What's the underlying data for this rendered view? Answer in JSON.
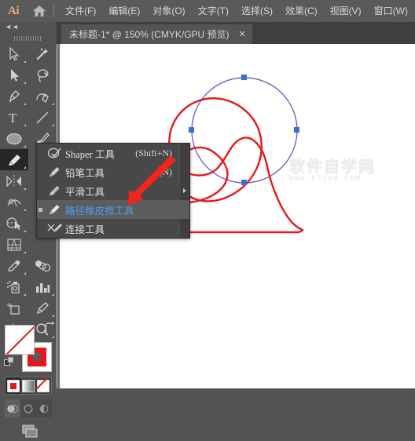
{
  "app": {
    "name": "Ai",
    "logo_icon": "illustrator-logo-icon",
    "home_icon": "home-icon"
  },
  "menubar": {
    "items": [
      {
        "label": "文件(F)",
        "name": "menu-file"
      },
      {
        "label": "编辑(E)",
        "name": "menu-edit"
      },
      {
        "label": "对象(O)",
        "name": "menu-object"
      },
      {
        "label": "文字(T)",
        "name": "menu-type"
      },
      {
        "label": "选择(S)",
        "name": "menu-select"
      },
      {
        "label": "效果(C)",
        "name": "menu-effect"
      },
      {
        "label": "视图(V)",
        "name": "menu-view"
      },
      {
        "label": "窗口(W)",
        "name": "menu-window"
      }
    ]
  },
  "document_tab": {
    "title": "未标题-1* @ 150% (CMYK/GPU 预览)",
    "close_label": "✕"
  },
  "toolbar": {
    "collapse_label": "◄◄",
    "tools": [
      {
        "name": "selection-tool-icon",
        "label": "选择工具"
      },
      {
        "name": "magic-wand-tool-icon",
        "label": "魔棒工具"
      },
      {
        "name": "direct-selection-tool-icon",
        "label": "直接选择工具"
      },
      {
        "name": "lasso-tool-icon",
        "label": "套索工具"
      },
      {
        "name": "pen-tool-icon",
        "label": "钢笔工具"
      },
      {
        "name": "curvature-tool-icon",
        "label": "曲率工具"
      },
      {
        "name": "type-tool-icon",
        "label": "文字工具"
      },
      {
        "name": "line-segment-tool-icon",
        "label": "直线段工具"
      },
      {
        "name": "ellipse-tool-icon",
        "label": "椭圆工具"
      },
      {
        "name": "paintbrush-tool-icon",
        "label": "画笔工具"
      },
      {
        "name": "shaper-tool-icon",
        "label": "Shaper 工具"
      },
      {
        "name": "rotate-tool-icon",
        "label": "旋转工具"
      },
      {
        "name": "reflect-tool-icon",
        "label": "镜像工具"
      },
      {
        "name": "width-tool-icon",
        "label": "宽度工具"
      },
      {
        "name": "free-transform-tool-icon",
        "label": "自由变换工具"
      },
      {
        "name": "shape-builder-tool-icon",
        "label": "形状生成器工具"
      },
      {
        "name": "perspective-grid-tool-icon",
        "label": "透视网格工具"
      },
      {
        "name": "mesh-tool-icon",
        "label": "网格工具"
      },
      {
        "name": "eyedropper-tool-icon",
        "label": "吸管工具"
      },
      {
        "name": "blend-tool-icon",
        "label": "混合工具"
      },
      {
        "name": "symbol-sprayer-tool-icon",
        "label": "符号喷枪工具"
      },
      {
        "name": "column-graph-tool-icon",
        "label": "柱形图工具"
      },
      {
        "name": "artboard-tool-icon",
        "label": "画板工具"
      },
      {
        "name": "slice-tool-icon",
        "label": "切片工具"
      },
      {
        "name": "hand-tool-icon",
        "label": "抓手工具"
      },
      {
        "name": "zoom-tool-icon",
        "label": "缩放工具"
      }
    ],
    "fill_stroke": {
      "fill_name": "fill-swatch",
      "fill_value": "无",
      "stroke_name": "stroke-swatch",
      "stroke_color": "#e8161c",
      "swap_icon": "swap-fill-stroke-icon",
      "default_icon": "default-fill-stroke-icon"
    },
    "paint_modes": [
      {
        "name": "color-swatch-button",
        "label": "颜色"
      },
      {
        "name": "gradient-swatch-button",
        "label": "渐变"
      },
      {
        "name": "none-swatch-button",
        "label": "无"
      }
    ],
    "draw_modes": [
      {
        "name": "draw-normal-button",
        "label": "正常绘图"
      },
      {
        "name": "draw-behind-button",
        "label": "背面绘图"
      },
      {
        "name": "draw-inside-button",
        "label": "内部绘图"
      }
    ],
    "screen_mode": {
      "name": "change-screen-mode-button",
      "label": "更改屏幕模式"
    }
  },
  "flyout_menu": {
    "items": [
      {
        "icon": "shaper-tool-icon",
        "label": "Shaper 工具",
        "shortcut": "(Shift+N)",
        "active": false,
        "selected": false
      },
      {
        "icon": "pencil-tool-icon",
        "label": "铅笔工具",
        "shortcut": "(N)",
        "active": false,
        "selected": false
      },
      {
        "icon": "smooth-tool-icon",
        "label": "平滑工具",
        "shortcut": "",
        "active": false,
        "selected": false
      },
      {
        "icon": "path-eraser-tool-icon",
        "label": "路径橡皮擦工具",
        "shortcut": "",
        "active": true,
        "selected": true
      },
      {
        "icon": "join-tool-icon",
        "label": "连接工具",
        "shortcut": "",
        "active": false,
        "selected": false
      }
    ]
  },
  "canvas": {
    "watermark_cn": "软件自学网",
    "watermark_url": "WWW.RJZXW.COM",
    "artwork": {
      "path_color": "#e8161c",
      "selection_color": "#7b5ec7",
      "anchor_color": "#3a6fd8",
      "description": "红色路径与紫色选中椭圆"
    }
  },
  "annotation": {
    "arrow_name": "red-pointer-arrow",
    "arrow_color": "#f5251b"
  }
}
